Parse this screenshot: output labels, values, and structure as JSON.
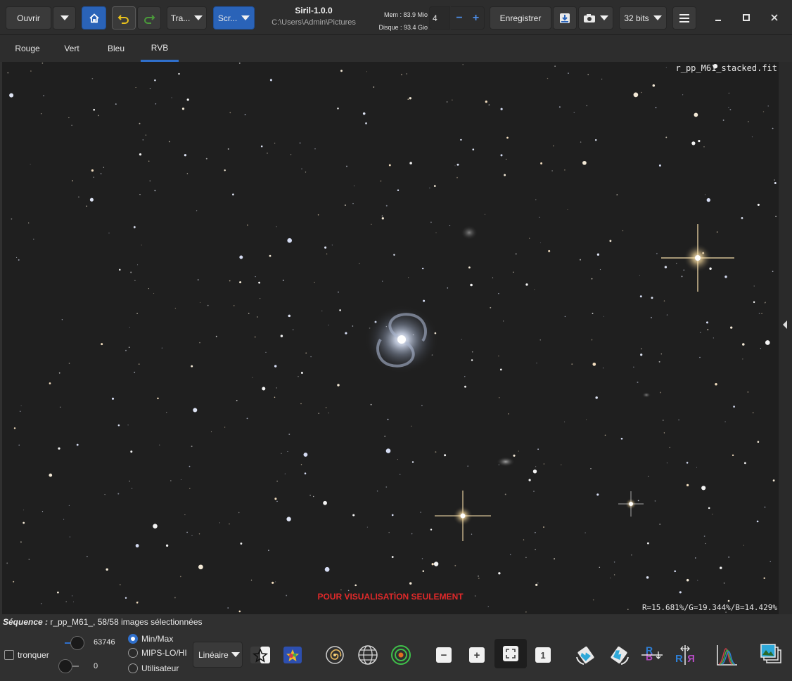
{
  "app": {
    "title": "Siril-1.0.0",
    "path": "C:\\Users\\Admin\\Pictures",
    "mem": "Mem : 83.9 Mio",
    "disk": "Disque : 93.4 Gio"
  },
  "toolbar": {
    "open_label": "Ouvrir",
    "processing_label": "Tra...",
    "scripts_label": "Scr...",
    "threads_value": "4",
    "save_label": "Enregistrer",
    "bitdepth_label": "32 bits"
  },
  "tabs": [
    {
      "label": "Rouge"
    },
    {
      "label": "Vert"
    },
    {
      "label": "Bleu"
    },
    {
      "label": "RVB"
    }
  ],
  "image": {
    "filename": "r_pp_M61_stacked.fit",
    "watermark": "POUR VISUALISATION SEULEMENT",
    "pixel_values": "R=15.681%/G=19.344%/B=14.429%"
  },
  "sequence": {
    "label": "Séquence :",
    "text": " r_pp_M61_, 58/58 images sélectionnées"
  },
  "display": {
    "clip_label": "tronquer",
    "high_value": "63746",
    "low_value": "0",
    "modes": [
      {
        "label": "Min/Max",
        "selected": true
      },
      {
        "label": "MIPS-LO/HI",
        "selected": false
      },
      {
        "label": "Utilisateur",
        "selected": false
      }
    ],
    "stretch_label": "Linéaire"
  },
  "colors": {
    "accent": "#2f6fcb",
    "warning": "#e0292a",
    "sky": "#1f1f1f"
  }
}
